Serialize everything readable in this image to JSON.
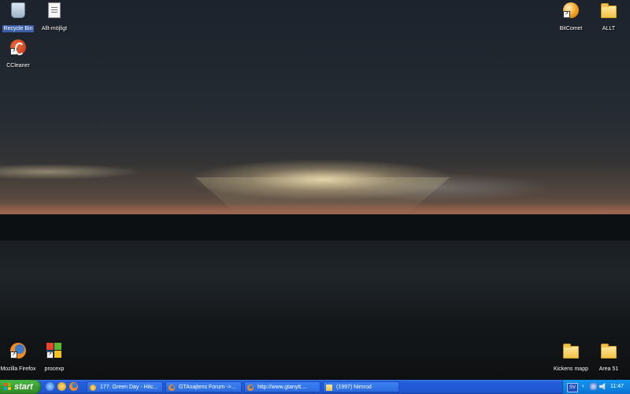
{
  "desktop": {
    "icons_left": [
      {
        "label": "Recycle Bin",
        "icon": "recycle-bin-icon",
        "selected": true
      },
      {
        "label": "Allt-möjligt",
        "icon": "document-icon"
      },
      {
        "label": "CCleaner",
        "icon": "ccleaner-icon"
      },
      {
        "label": "Mozilla Firefox",
        "icon": "firefox-icon"
      },
      {
        "label": "procexp",
        "icon": "procexp-icon"
      }
    ],
    "icons_right": [
      {
        "label": "BitComet",
        "icon": "bitcomet-icon"
      },
      {
        "label": "ALLT",
        "icon": "folder-icon"
      },
      {
        "label": "Kickens mapp",
        "icon": "folder-icon"
      },
      {
        "label": "Area 51",
        "icon": "folder-icon"
      }
    ]
  },
  "taskbar": {
    "start_label": "start",
    "tasks": [
      {
        "label": "177. Green Day - Hitc...",
        "icon": "winamp-icon"
      },
      {
        "label": "GTAsajtens Forum ->...",
        "icon": "firefox-icon"
      },
      {
        "label": "http://www.gtanytt....",
        "icon": "firefox-icon"
      },
      {
        "label": "(1997) Nimrod",
        "icon": "folder-icon"
      }
    ],
    "tray": {
      "language": "SV",
      "clock": "11:47"
    }
  },
  "colors": {
    "taskbar_blue": "#245edb",
    "start_green": "#3a9d2f",
    "tray_blue": "#0d84e1"
  }
}
